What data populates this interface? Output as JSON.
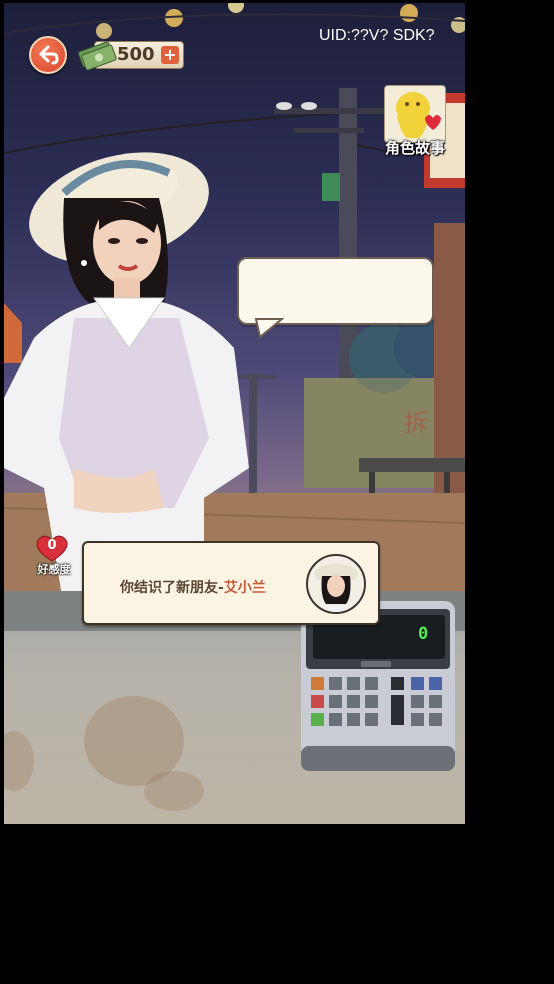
{
  "hud": {
    "money": "500",
    "uid_text": "UID:??V? SDK?"
  },
  "story": {
    "label": "角色故事"
  },
  "affection": {
    "value": "0",
    "label": "好感度"
  },
  "dialog": {
    "message": "你结识了新朋友-",
    "friend_name": "艾小兰"
  },
  "register": {
    "display_value": "0"
  },
  "colors": {
    "accent": "#d9442c",
    "highlight_name": "#c85a3c",
    "display_green": "#4ef04e"
  }
}
